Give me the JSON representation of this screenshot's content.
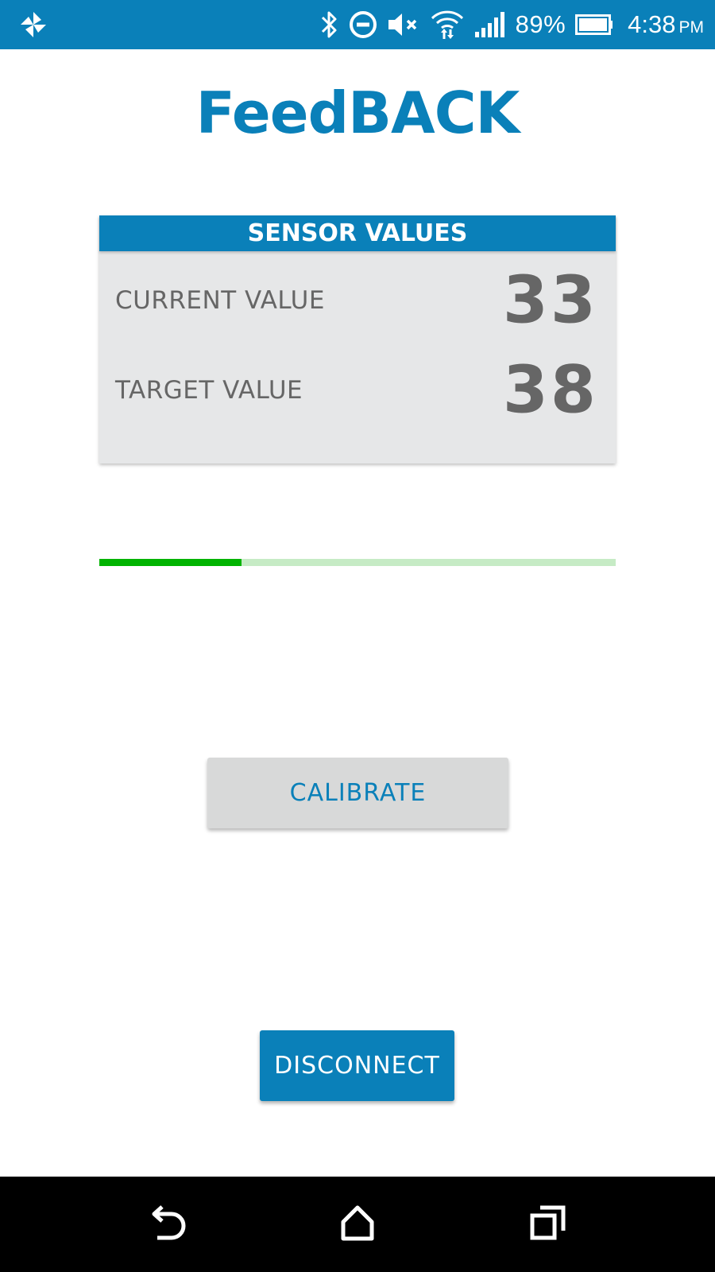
{
  "status_bar": {
    "battery_percent": "89%",
    "time": "4:38",
    "ampm": "PM",
    "icons": [
      "pinwheel-app-icon",
      "bluetooth-icon",
      "do-not-disturb-icon",
      "volume-muted-icon",
      "wifi-icon",
      "signal-icon",
      "battery-icon"
    ]
  },
  "app": {
    "title": "FeedBACK"
  },
  "sensor_card": {
    "header": "SENSOR VALUES",
    "current_label": "CURRENT VALUE",
    "current_value": "33",
    "target_label": "TARGET VALUE",
    "target_value": "38"
  },
  "progress": {
    "fraction": 0.275,
    "fill_color": "#00b300",
    "track_color": "#c6ebc5"
  },
  "buttons": {
    "calibrate_label": "CALIBRATE",
    "disconnect_label": "DISCONNECT"
  },
  "nav_bar": {
    "icons": [
      "back-icon",
      "home-icon",
      "recents-icon"
    ]
  },
  "colors": {
    "accent": "#0a80b9",
    "card_bg": "#e6e7e8",
    "text_gray": "#666666"
  }
}
